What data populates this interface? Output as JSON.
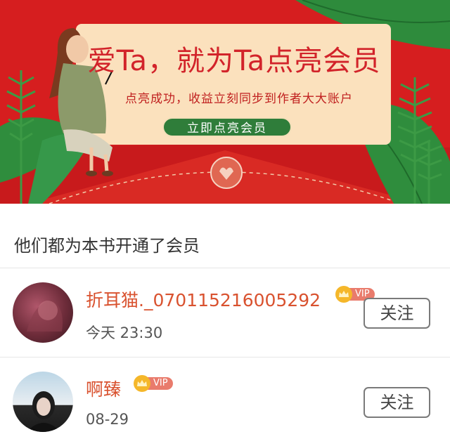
{
  "banner": {
    "headline": "爱Ta，就为Ta点亮会员",
    "subline": "点亮成功，收益立刻同步到作者大大账户",
    "cta_label": "立即点亮会员",
    "colors": {
      "background": "#d61e1f",
      "card": "#fbe1bd",
      "cta": "#2f7d3a",
      "headline": "#d2232a"
    }
  },
  "section": {
    "title": "他们都为本书开通了会员"
  },
  "members": [
    {
      "name": "折耳猫._070115216005292",
      "vip_label": "VIP",
      "time": "今天 23:30",
      "follow_label": "关注"
    },
    {
      "name": "啊臻",
      "vip_label": "VIP",
      "time": "08-29",
      "follow_label": "关注"
    }
  ]
}
